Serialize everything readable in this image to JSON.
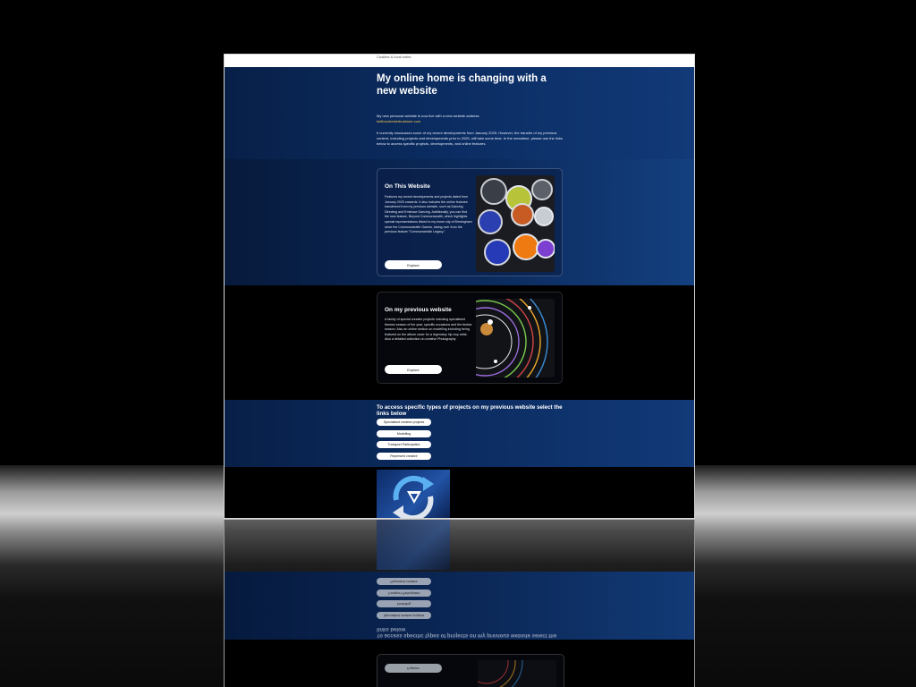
{
  "page": {
    "cookie_text": "Cookies & local notes",
    "hero": {
      "title": "My online home is changing with a new website",
      "intro": "My new personal website is now live with a new website address",
      "new_address": "keithrochesterbusbone.com",
      "body": "It currently showcases some of my recent developments from January 2025. However, the transfer of my previous content, including projects and developments prior to 2025, will take some time. In the meantime, please use the links below to access specific projects, developments, and online features."
    },
    "cards": [
      {
        "title": "On This Website",
        "description": "Features my recent developments and projects dated from January 2025 onwards. It also includes the online features transferred from my previous website, such as Dancing Directing and Embrace Dancing. Additionally, you can find the new feature, Beyond Commonwealth, which highlights special representations linked to my home city of Birmingham since the Commonwealth Games, taking over from the previous feature \"Commonwealth Legacy.\"",
        "button": "Explore"
      },
      {
        "title": "On my previous website",
        "description": "A family of special creative projects including specialised themes season of the year, specific occasions and the festive season. Also an online section on modelling including being featured on the album cover for a legendary hip-hop artist. Also a detailed collection on creative Photography",
        "button": "Explore"
      }
    ],
    "links_section": {
      "heading": "To access specific types of projects on my previous website select the links below",
      "links": [
        "Specialised creative projects",
        "Modelling",
        "Transport Participation",
        "Represent creative"
      ]
    },
    "icons": {
      "logo": "refresh-cycle-logo-icon",
      "thumb1": "paint-pots-image",
      "thumb2": "circular-timeline-image"
    },
    "colors": {
      "hero_blue": "#0b2d63",
      "link_yellow": "#f3c84b",
      "pill_bg": "#ffffff"
    }
  }
}
